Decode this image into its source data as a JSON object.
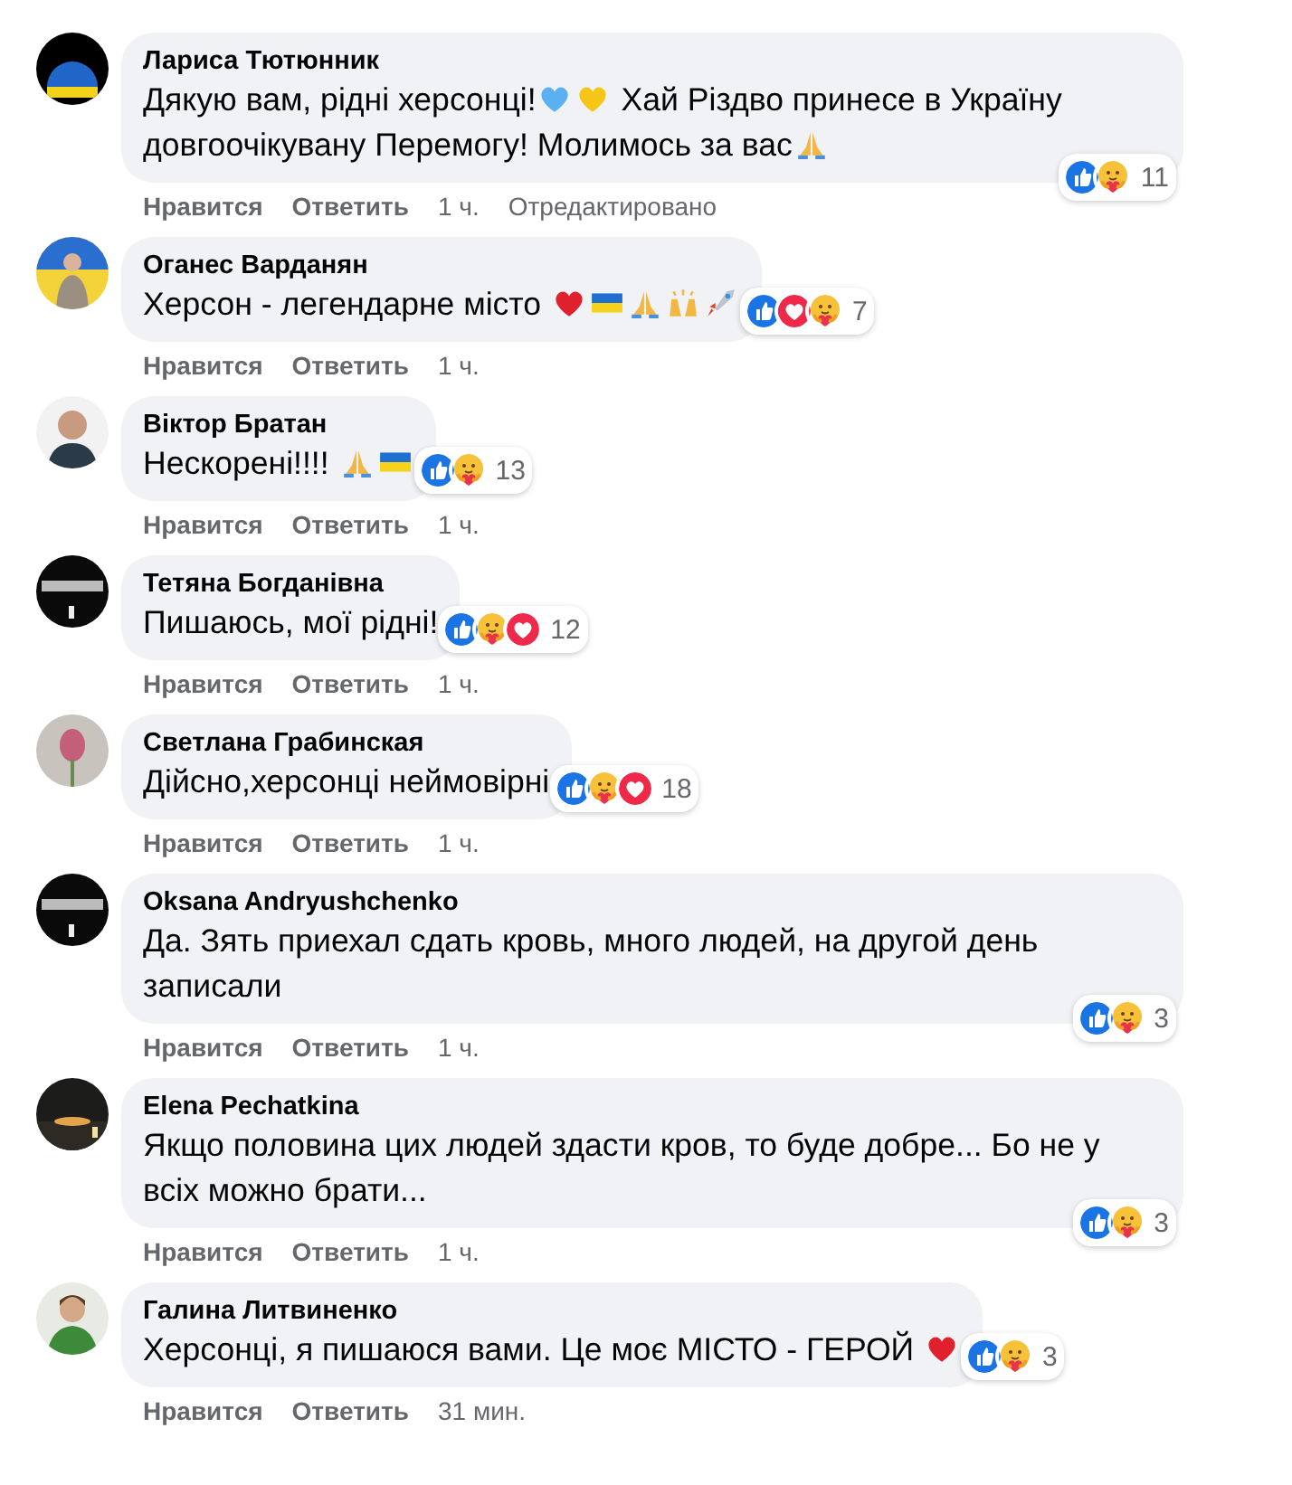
{
  "comments": [
    {
      "author": "Лариса Тютюнник",
      "parts": [
        {
          "kind": "text",
          "text": "Дякую вам, рідні херсонці!"
        },
        {
          "kind": "blue_heart"
        },
        {
          "kind": "yellow_heart"
        },
        {
          "kind": "text",
          "text": " Хай Різдво принесе в Україну довгоочікувану Перемогу! Молимось за вас"
        },
        {
          "kind": "pray"
        }
      ],
      "reactions": [
        {
          "kind": "like"
        },
        {
          "kind": "care"
        }
      ],
      "reaction_count": "11",
      "like": "Нравится",
      "reply": "Ответить",
      "time": "1 ч.",
      "edited": "Отредактировано"
    },
    {
      "author": "Оганес Варданян",
      "parts": [
        {
          "kind": "text",
          "text": "Херсон - легендарне місто "
        },
        {
          "kind": "red_heart"
        },
        {
          "kind": "flag"
        },
        {
          "kind": "pray"
        },
        {
          "kind": "clap"
        },
        {
          "kind": "rocket"
        }
      ],
      "reactions": [
        {
          "kind": "like"
        },
        {
          "kind": "love"
        },
        {
          "kind": "care"
        }
      ],
      "reaction_count": "7",
      "like": "Нравится",
      "reply": "Ответить",
      "time": "1 ч."
    },
    {
      "author": "Віктор Братан",
      "parts": [
        {
          "kind": "text",
          "text": "Нескорені!!!! "
        },
        {
          "kind": "pray"
        },
        {
          "kind": "flag"
        }
      ],
      "reactions": [
        {
          "kind": "like"
        },
        {
          "kind": "care"
        }
      ],
      "reaction_count": "13",
      "like": "Нравится",
      "reply": "Ответить",
      "time": "1 ч."
    },
    {
      "author": "Тетяна Богданівна",
      "parts": [
        {
          "kind": "text",
          "text": "Пишаюсь, мої рідні!"
        }
      ],
      "reactions": [
        {
          "kind": "like"
        },
        {
          "kind": "care"
        },
        {
          "kind": "love"
        }
      ],
      "reaction_count": "12",
      "like": "Нравится",
      "reply": "Ответить",
      "time": "1 ч."
    },
    {
      "author": "Светлана Грабинская",
      "parts": [
        {
          "kind": "text",
          "text": "Дійсно,херсонці неймовірні"
        }
      ],
      "reactions": [
        {
          "kind": "like"
        },
        {
          "kind": "care"
        },
        {
          "kind": "love"
        }
      ],
      "reaction_count": "18",
      "like": "Нравится",
      "reply": "Ответить",
      "time": "1 ч."
    },
    {
      "author": "Oksana Andryushchenko",
      "parts": [
        {
          "kind": "text",
          "text": "Да. Зять приехал сдать кровь, много людей, на другой день записали"
        }
      ],
      "reactions": [
        {
          "kind": "like"
        },
        {
          "kind": "care"
        }
      ],
      "reaction_count": "3",
      "like": "Нравится",
      "reply": "Ответить",
      "time": "1 ч."
    },
    {
      "author": "Elena Pechatkina",
      "parts": [
        {
          "kind": "text",
          "text": "Якщо половина цих людей здасти кров, то буде добре... Бо не у всіх можно брати..."
        }
      ],
      "reactions": [
        {
          "kind": "like"
        },
        {
          "kind": "care"
        }
      ],
      "reaction_count": "3",
      "like": "Нравится",
      "reply": "Ответить",
      "time": "1 ч."
    },
    {
      "author": "Галина Литвиненко",
      "parts": [
        {
          "kind": "text",
          "text": "Херсонці, я пишаюся вами. Це моє МІСТО - ГЕРОЙ "
        },
        {
          "kind": "red_heart"
        }
      ],
      "reactions": [
        {
          "kind": "like"
        },
        {
          "kind": "care"
        }
      ],
      "reaction_count": "3",
      "like": "Нравится",
      "reply": "Ответить",
      "time": "31 мин."
    }
  ]
}
